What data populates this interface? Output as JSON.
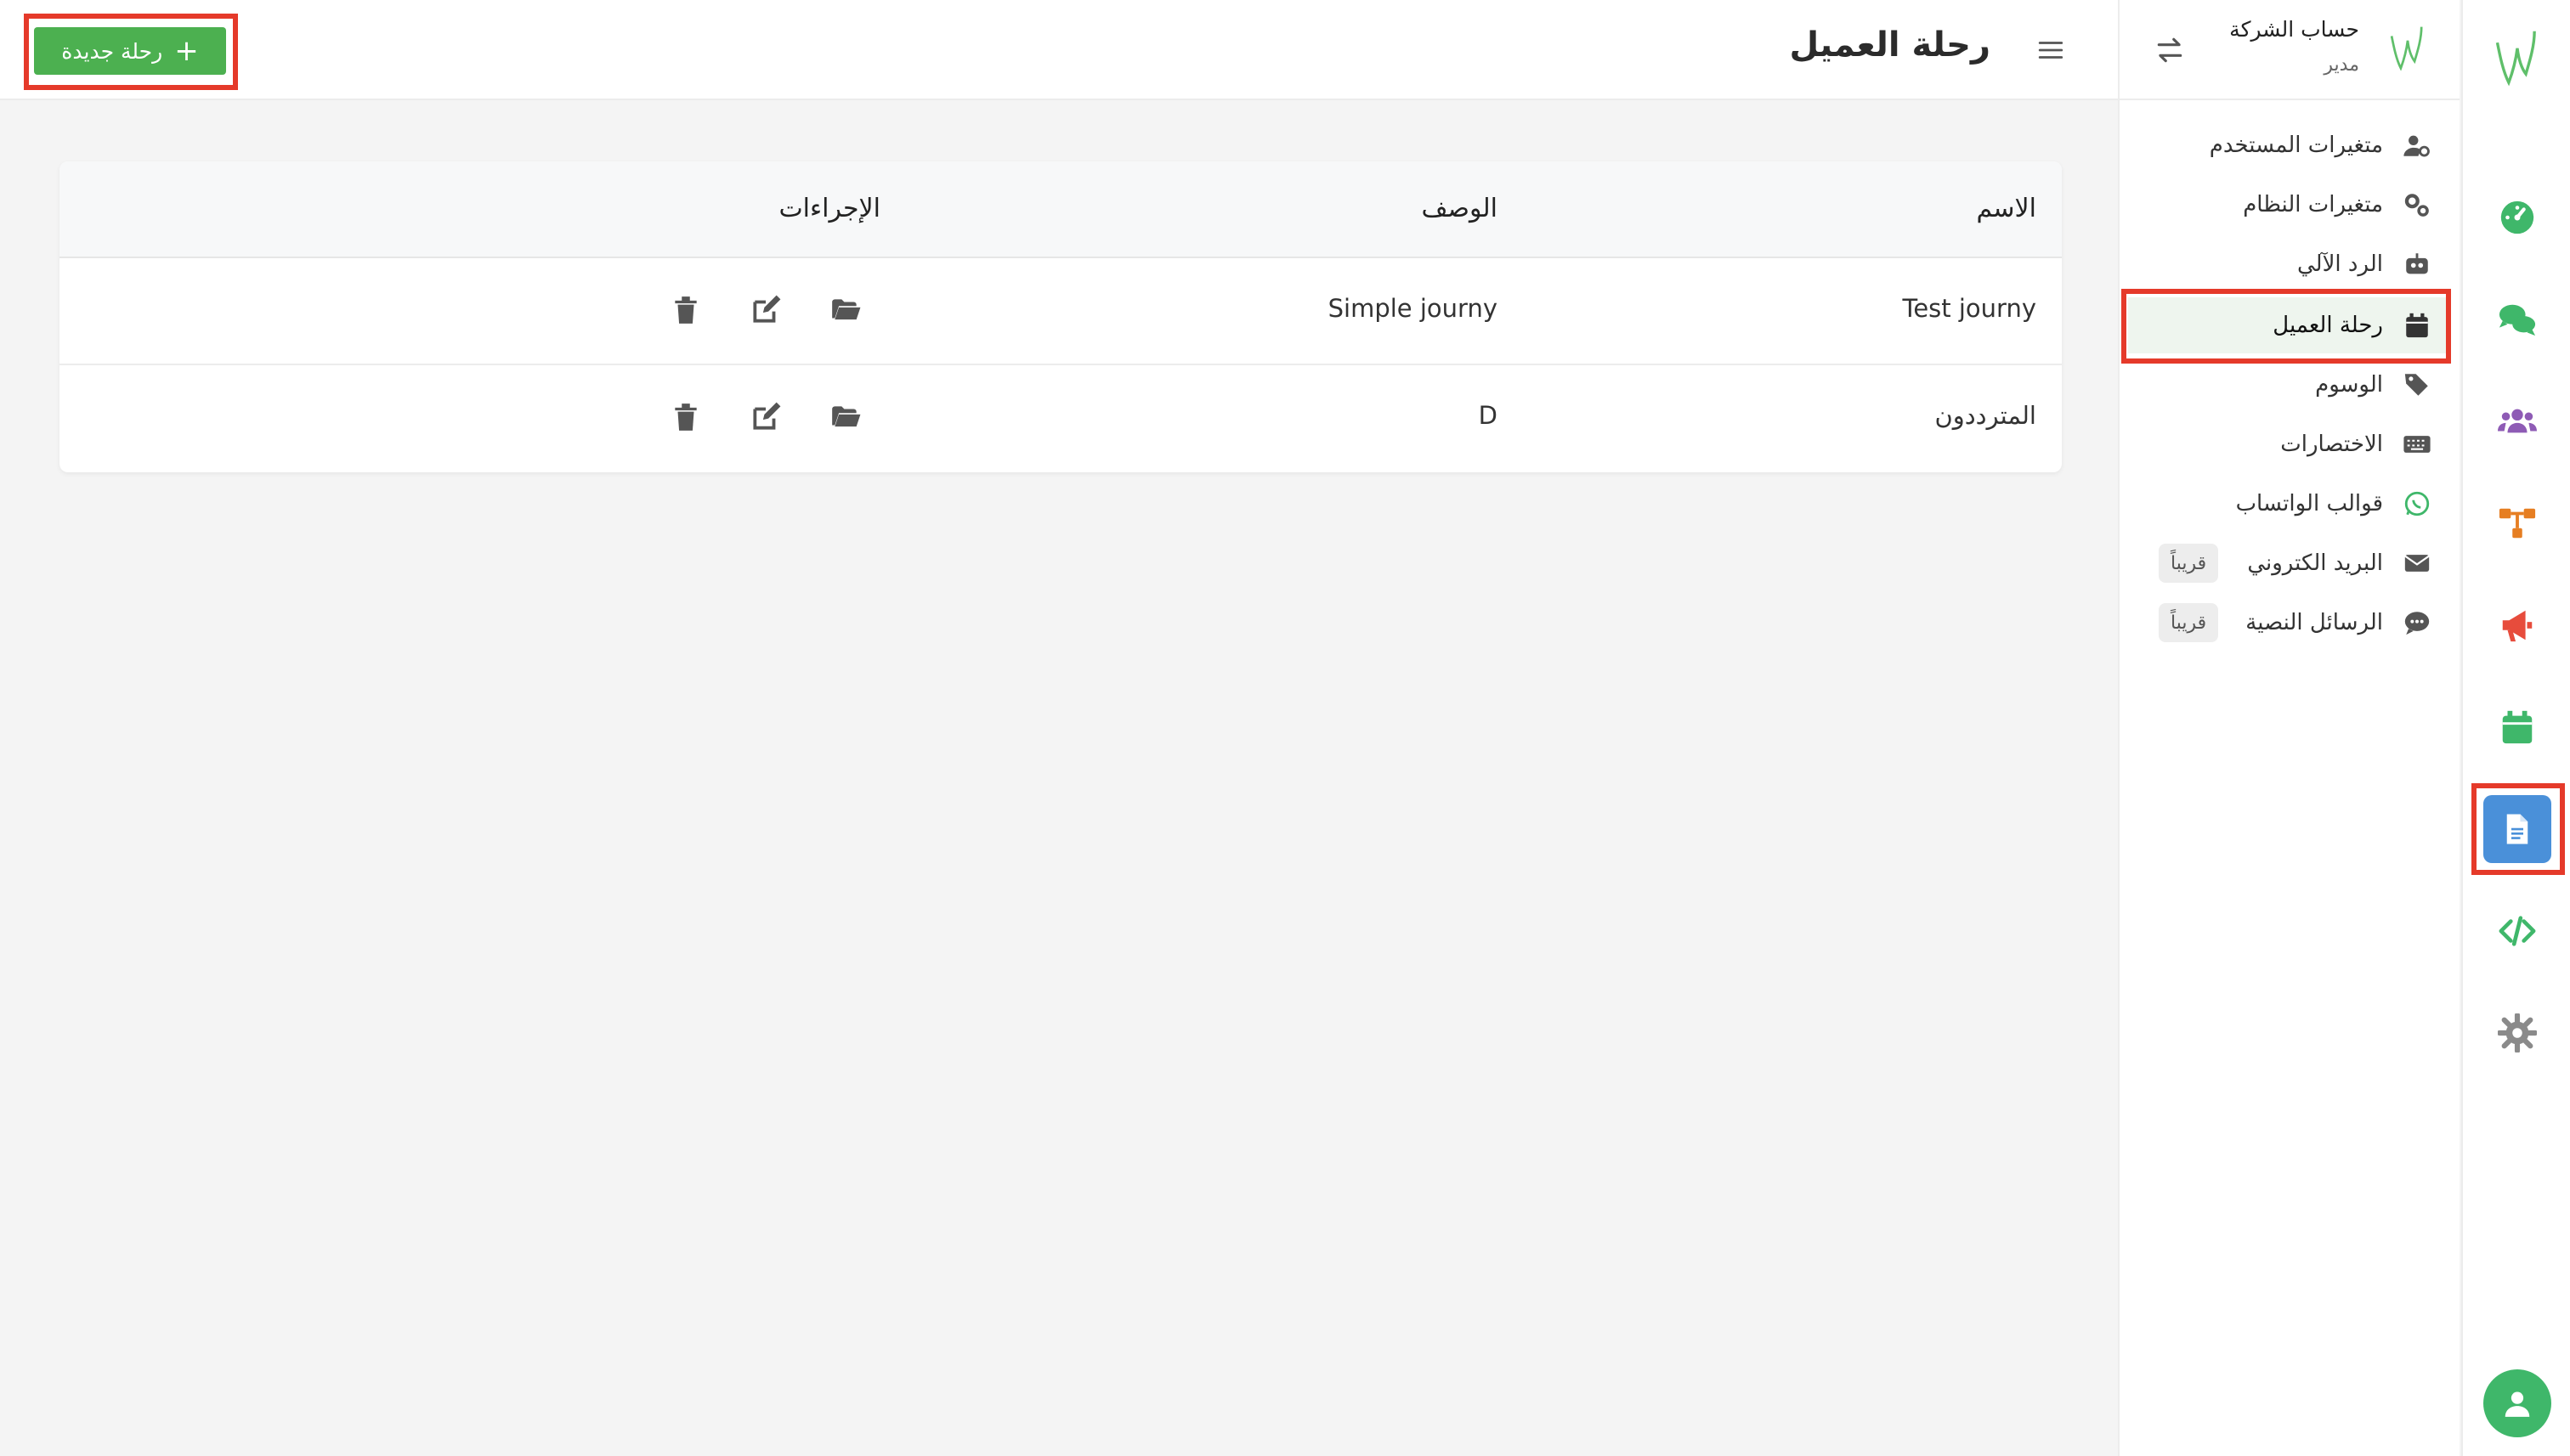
{
  "header": {
    "page_title": "رحلة العميل",
    "new_button_label": "رحلة جديدة",
    "new_button_icon": "plus-icon"
  },
  "company": {
    "name": "حساب الشركة",
    "role": "مدير"
  },
  "sidebar": {
    "items": [
      {
        "label": "متغيرات المستخدم",
        "icon": "user-gear-icon"
      },
      {
        "label": "متغيرات النظام",
        "icon": "gears-icon"
      },
      {
        "label": "الرد الآلي",
        "icon": "robot-icon"
      },
      {
        "label": "رحلة العميل",
        "icon": "calendar-icon",
        "active": true
      },
      {
        "label": "الوسوم",
        "icon": "tags-icon"
      },
      {
        "label": "الاختصارات",
        "icon": "keyboard-icon"
      },
      {
        "label": "قوالب الواتساب",
        "icon": "whatsapp-icon"
      },
      {
        "label": "البريد الكتروني",
        "icon": "envelope-icon",
        "badge": "قريباً"
      },
      {
        "label": "الرسائل النصية",
        "icon": "comment-dots-icon",
        "badge": "قريباً"
      }
    ]
  },
  "rail": {
    "items": [
      {
        "icon": "dashboard-icon",
        "color": "#3fb76a"
      },
      {
        "icon": "chat-icon",
        "color": "#3fb76a"
      },
      {
        "icon": "users-icon",
        "color": "#8e5bb5"
      },
      {
        "icon": "flow-icon",
        "color": "#e67e22"
      },
      {
        "icon": "megaphone-icon",
        "color": "#e74c3c"
      },
      {
        "icon": "calendar-icon",
        "color": "#3fb76a"
      },
      {
        "icon": "document-icon",
        "color": "#4a90d9",
        "active": true
      },
      {
        "icon": "code-icon",
        "color": "#3fb76a"
      },
      {
        "icon": "settings-icon",
        "color": "#8a8a8a"
      }
    ],
    "avatar_icon": "user-icon"
  },
  "table": {
    "columns": [
      "الاسم",
      "الوصف",
      "الإجراءات"
    ],
    "rows": [
      {
        "name": "Test journy",
        "description": "Simple journy"
      },
      {
        "name": "المترددون",
        "description": "D"
      }
    ],
    "actions": [
      "folder-open-icon",
      "edit-icon",
      "trash-icon"
    ]
  },
  "colors": {
    "brand_green": "#4cb050",
    "active_blue": "#4a90d9",
    "highlight_red": "#e53a2a"
  }
}
